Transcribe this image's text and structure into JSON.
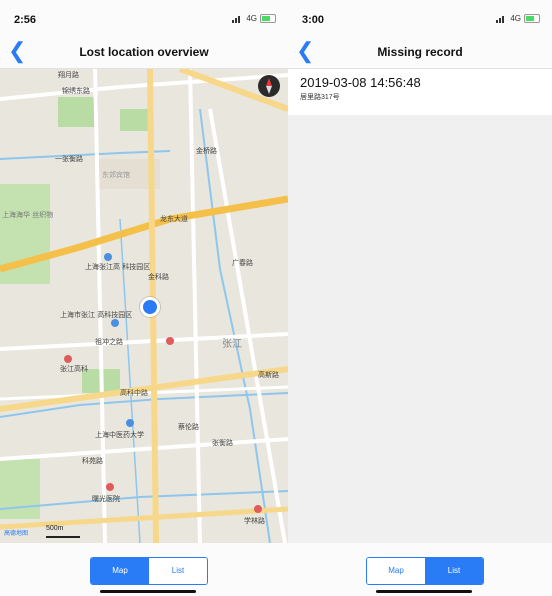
{
  "left_screen": {
    "status_time": "2:56",
    "network": "4G",
    "nav_title": "Lost location overview",
    "map_scale": "500m",
    "map_logo": "高德地图",
    "map_labels": {
      "road1": "翔月路",
      "road2": "锦绣东路",
      "road3": "一张衡路",
      "hotel": "东郊宾馆",
      "fabric": "上海海华 丝织物",
      "longdong": "龙东大道",
      "park1": "上海张江高 科技园区",
      "park2": "上海市张江 高科技园区",
      "jinke": "金科路",
      "zuchongzhi": "祖冲之路",
      "zhangjiang_gaoke": "张江高科",
      "zhangjiang": "张江",
      "gaokezhong": "高科中路",
      "tcm": "上海中医药大学",
      "cailun": "蔡伦路",
      "zhanghong": "张衡路",
      "kexiang": "科苑路",
      "shuguang": "曙光医院",
      "xuelin": "学林路",
      "gaosi": "高斯路",
      "jinqiao": "金桥路",
      "guangchun": "广春路"
    }
  },
  "right_screen": {
    "status_time": "3:00",
    "network": "4G",
    "nav_title": "Missing record",
    "records": [
      {
        "time": "2019-03-08 14:56:48",
        "address": "居里路317号"
      }
    ]
  },
  "segmented": {
    "map_label": "Map",
    "list_label": "List"
  },
  "colors": {
    "accent": "#2a7cf6",
    "map_bg": "#e9e6dd"
  }
}
